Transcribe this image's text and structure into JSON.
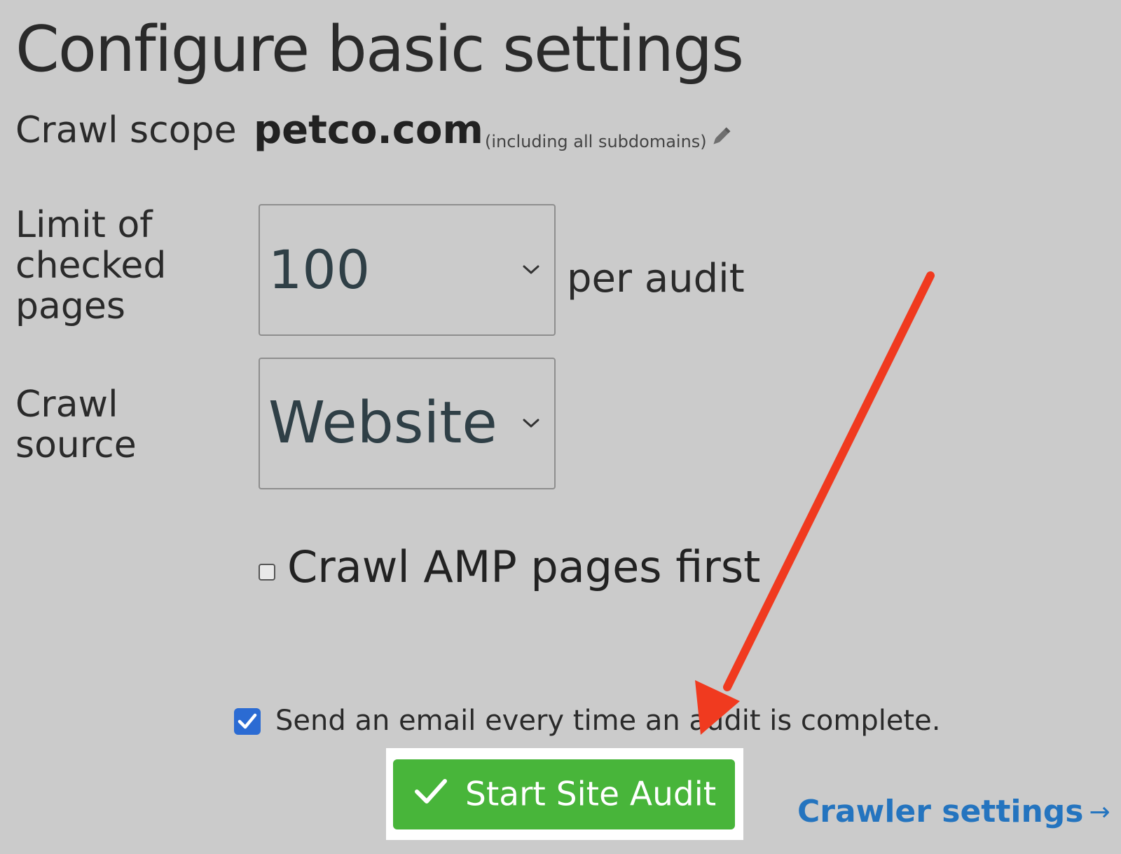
{
  "page": {
    "title": "Configure basic settings"
  },
  "crawl_scope": {
    "label": "Crawl scope",
    "domain": "petco.com",
    "note": "(including all subdomains)",
    "edit_icon": "pencil-icon"
  },
  "limit": {
    "label": "Limit of checked pages",
    "selected": "100",
    "suffix": "per audit"
  },
  "source": {
    "label": "Crawl source",
    "selected": "Website"
  },
  "amp": {
    "label": "Crawl AMP pages first",
    "checked": false
  },
  "email": {
    "label": "Send an email every time an audit is complete.",
    "checked": true
  },
  "actions": {
    "start_label": "Start Site Audit",
    "start_icon": "checkmark-icon",
    "crawler_settings_label": "Crawler settings",
    "crawler_settings_arrow": "→"
  },
  "colors": {
    "background": "#cbcbcb",
    "start_button": "#48b53a",
    "link": "#2474bf",
    "checkbox_checked": "#2b6bd3",
    "annotation_arrow": "#f03a1f"
  }
}
